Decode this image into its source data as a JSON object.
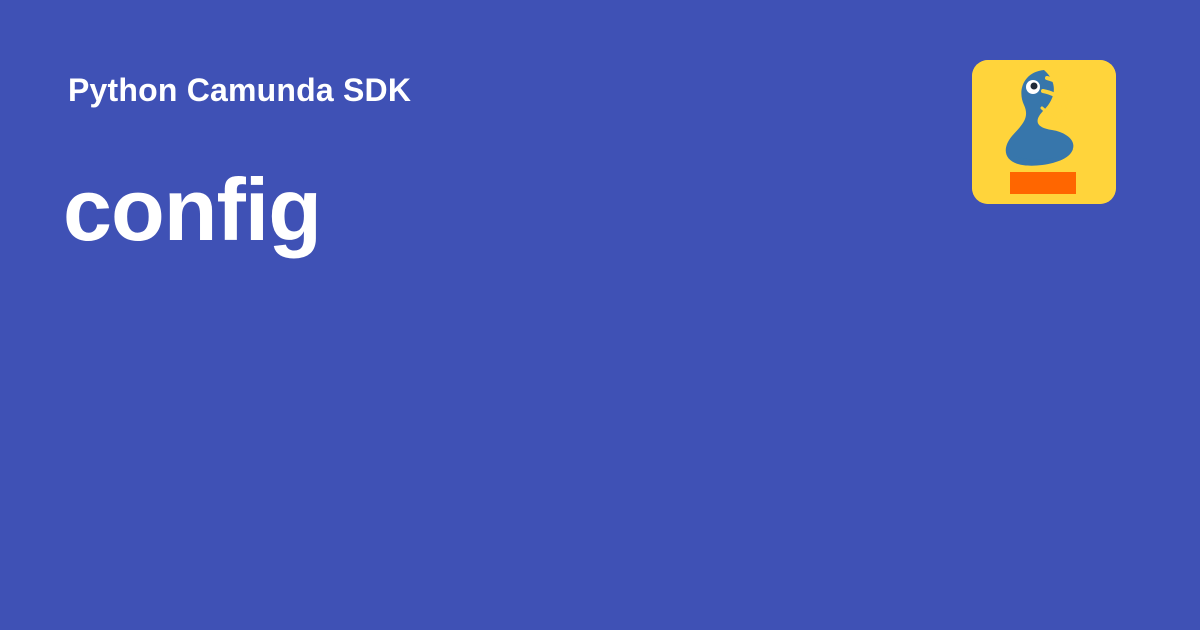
{
  "site": {
    "name": "Python Camunda SDK"
  },
  "page": {
    "title": "config"
  },
  "logo": {
    "icon": "snake-logo-icon",
    "colors": {
      "background": "#FFD43B",
      "snake": "#3776AB",
      "stand": "#FF6600"
    }
  },
  "theme": {
    "background": "#3F51B5",
    "text": "#FFFFFF"
  }
}
